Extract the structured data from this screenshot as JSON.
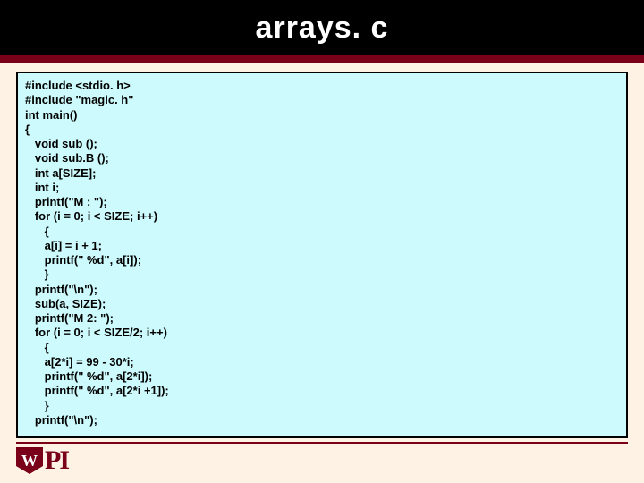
{
  "title": "arrays. c",
  "code_lines": [
    "#include <stdio. h>",
    "#include \"magic. h\"",
    "int main()",
    "{",
    "   void sub ();",
    "   void sub.B ();",
    "   int a[SIZE];",
    "   int i;",
    "   printf(\"M : \");",
    "   for (i = 0; i < SIZE; i++)",
    "      {",
    "      a[i] = i + 1;",
    "      printf(\" %d\", a[i]);",
    "      }",
    "   printf(\"\\n\");",
    "   sub(a, SIZE);",
    "   printf(\"M 2: \");",
    "   for (i = 0; i < SIZE/2; i++)",
    "      {",
    "      a[2*i] = 99 - 30*i;",
    "      printf(\" %d\", a[2*i]);",
    "      printf(\" %d\", a[2*i +1]);",
    "      }",
    "   printf(\"\\n\");"
  ],
  "logo": {
    "text": "PI",
    "shield_letter": "W"
  }
}
